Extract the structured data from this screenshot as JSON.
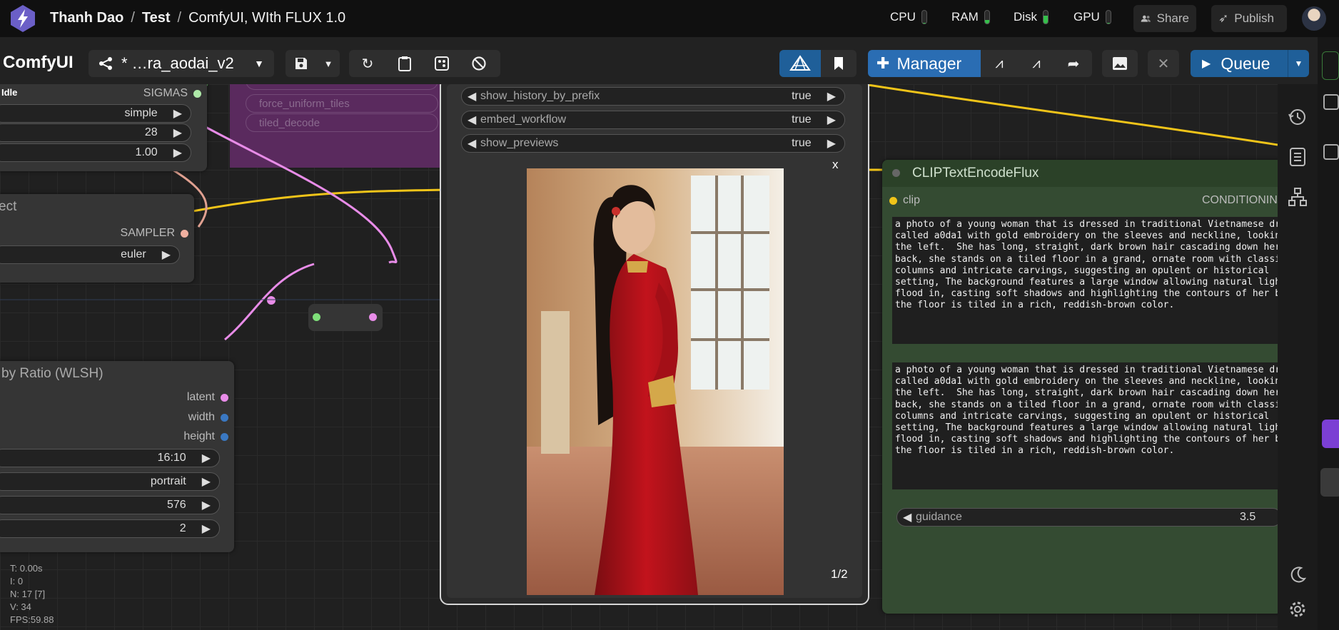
{
  "topbar": {
    "user": "Thanh Dao",
    "project": "Test",
    "workflow_title": "ComfyUI, WIth FLUX 1.0",
    "separator": "/",
    "meters": [
      {
        "label": "CPU",
        "level": 0.05
      },
      {
        "label": "RAM",
        "level": 0.3
      },
      {
        "label": "Disk",
        "level": 0.6
      },
      {
        "label": "GPU",
        "level": 0.05
      }
    ],
    "share_label": "Share",
    "publish_label": "Publish"
  },
  "menubar": {
    "brand": "ComfyUI",
    "workflow_name": "* …ra_aodai_v2",
    "manager_label": "Manager",
    "queue_label": "Queue",
    "close_symbol": "✕"
  },
  "status": "Idle",
  "nodes": {
    "scheduler": {
      "output": "SIGMAS",
      "widgets": [
        "simple",
        "28",
        "1.00"
      ]
    },
    "sampler_select": {
      "title": "ect",
      "output": "SAMPLER",
      "widget": "euler"
    },
    "latent_ratio": {
      "title": "by Ratio (WLSH)",
      "outputs": [
        "latent",
        "width",
        "height"
      ],
      "widgets": [
        "16:10",
        "portrait",
        "576",
        "2"
      ]
    },
    "purple_group": {
      "items": [
        "force_uniform_tiles",
        "tiled_decode"
      ]
    },
    "preview": {
      "widgets": [
        {
          "label": "show_history_by_prefix",
          "value": "true"
        },
        {
          "label": "embed_workflow",
          "value": "true"
        },
        {
          "label": "show_previews",
          "value": "true"
        }
      ],
      "close": "x",
      "pager": "1/2"
    },
    "clip": {
      "title": "CLIPTextEncodeFlux",
      "input": "clip",
      "output": "CONDITIONIN",
      "prompt_1": "a photo of a young woman that is dressed in traditional Vietnamese dres\ncalled a0da1 with gold embroidery on the sleeves and neckline, looking\nthe left.  She has long, straight, dark brown hair cascading down her\nback, she stands on a tiled floor in a grand, ornate room with classica\ncolumns and intricate carvings, suggesting an opulent or historical\nsetting, The background features a large window allowing natural light\nflood in, casting soft shadows and highlighting the contours of her bod\nthe floor is tiled in a rich, reddish-brown color.",
      "prompt_2": "a photo of a young woman that is dressed in traditional Vietnamese dres\ncalled a0da1 with gold embroidery on the sleeves and neckline, looking\nthe left.  She has long, straight, dark brown hair cascading down her\nback, she stands on a tiled floor in a grand, ornate room with classica\ncolumns and intricate carvings, suggesting an opulent or historical\nsetting, The background features a large window allowing natural light\nflood in, casting soft shadows and highlighting the contours of her bod\nthe floor is tiled in a rich, reddish-brown color.",
      "guidance_label": "guidance",
      "guidance_value": "3.5"
    }
  },
  "stats": {
    "t": "T: 0.00s",
    "i": "I: 0",
    "n": "N: 17 [7]",
    "v": "V: 34",
    "fps": "FPS:59.88"
  },
  "colors": {
    "accent_blue": "#1f5f99",
    "manager_blue": "#2a6db3",
    "clip_green": "#344b32",
    "wire_yellow": "#f0c419",
    "wire_pink": "#e88ce8",
    "wire_salmon": "#e0a090"
  },
  "icons": [
    "share-icon",
    "save-icon",
    "chevron-down-icon",
    "refresh-icon",
    "clipboard-icon",
    "fit-view-icon",
    "cancel-icon",
    "history-icon",
    "list-icon",
    "node-tree-icon",
    "moon-icon",
    "gear-icon",
    "image-icon",
    "play-icon"
  ]
}
